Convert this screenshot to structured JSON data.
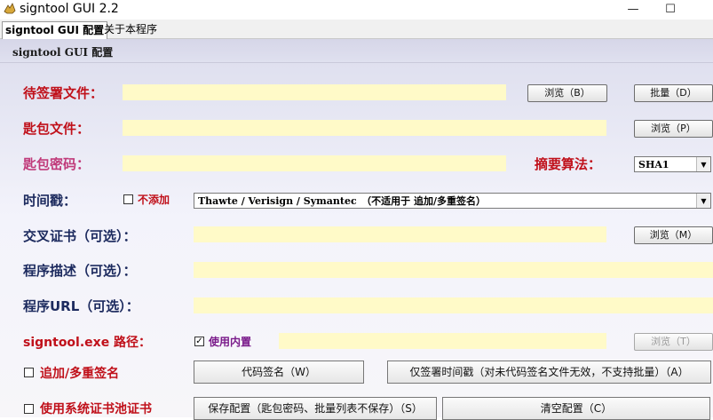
{
  "window": {
    "title": "signtool GUI 2.2",
    "minimize": "—",
    "maximize": "☐"
  },
  "tabs": [
    {
      "label": "signtool GUI 配置"
    },
    {
      "label": "关于本程序"
    }
  ],
  "panel": {
    "title": "signtool GUI 配置"
  },
  "form": {
    "file_label": "待签署文件：",
    "key_label": "匙包文件：",
    "password_label": "匙包密码：",
    "digest_label": "摘要算法：",
    "timestamp_label": "时间戳：",
    "cross_cert_label": "交叉证书（可选）：",
    "desc_label": "程序描述（可选）：",
    "url_label": "程序URL（可选）：",
    "signtool_label": "signtool.exe 路径：",
    "digest_value": "SHA1",
    "timestamp_value": "Thawte / Verisign / Symantec　（不适用于 追加/多重签名）",
    "no_timestamp": "不添加",
    "builtin": "使用内置",
    "append_sign": "追加/多重签名",
    "use_cert_pool": "使用系统证书池证书"
  },
  "buttons": {
    "browse_b": "浏览（B）",
    "batch_d": "批量（D）",
    "browse_p": "浏览（P）",
    "browse_m": "浏览（M）",
    "browse_t": "浏览（T）",
    "sign_w": "代码签名（W）",
    "timestamp_only_a": "仅签署时间戳（对未代码签名文件无效，不支持批量）（A）",
    "save_config_s": "保存配置（匙包密码、批量列表不保存）（S）",
    "clear_config_c": "清空配置（C）"
  }
}
